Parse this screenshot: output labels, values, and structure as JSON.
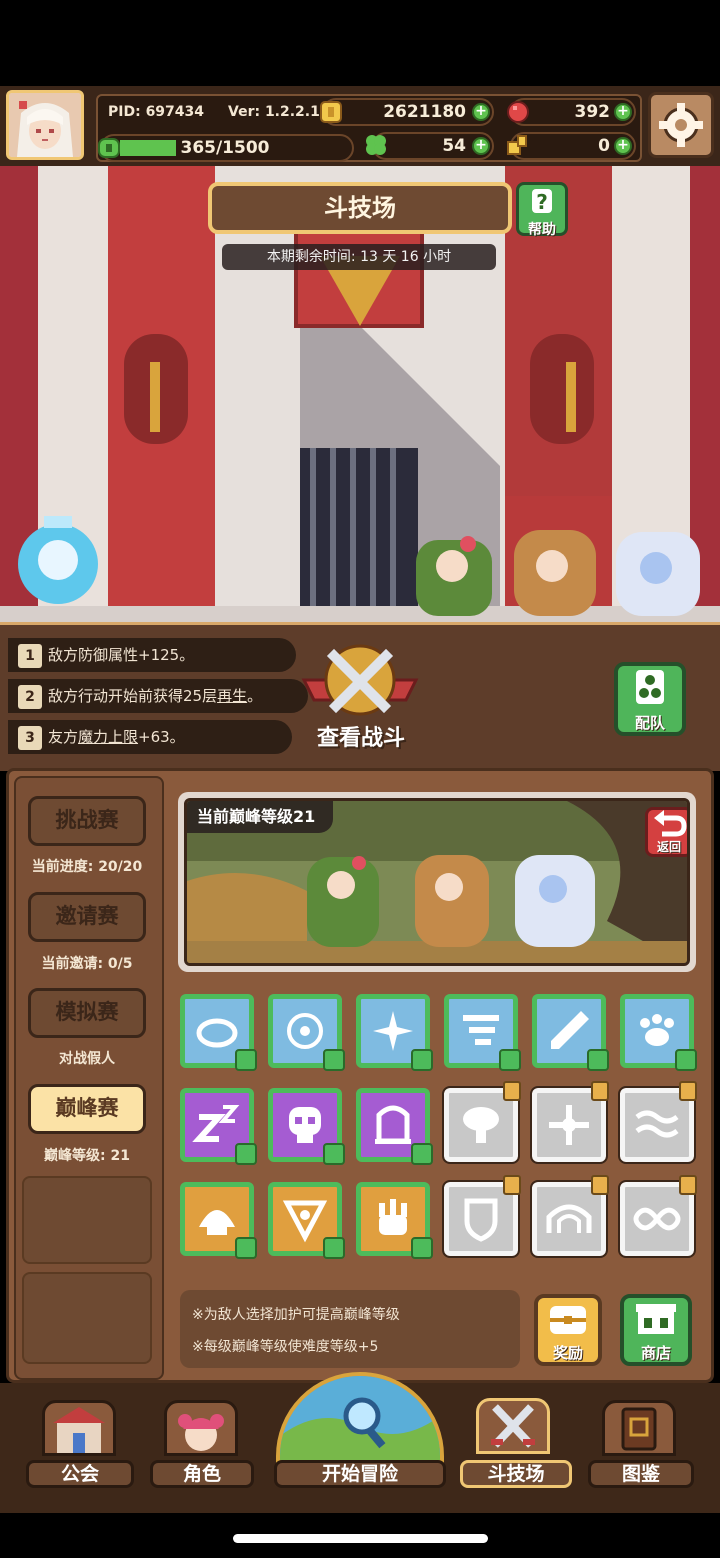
{
  "status_bar": {
    "pid": "PID: 697434",
    "version": "Ver: 1.2.2.1",
    "gold": "2621180",
    "gems": "392",
    "stamina": "365/1500",
    "stamina_fill": 0.243,
    "clover": "54",
    "tickets": "0"
  },
  "arena": {
    "title": "斗技场",
    "help_label": "帮助",
    "timer": "本期剩余时间: 13 天 16 小时"
  },
  "buffs": [
    {
      "num": "1",
      "text": "敌方防御属性+125。"
    },
    {
      "num": "2",
      "text_a": "敌方行动开始前获得25层",
      "text_u": "再生",
      "text_b": "。"
    },
    {
      "num": "3",
      "text_a": "友方",
      "text_u": "魔力上限",
      "text_b": "+63。"
    }
  ],
  "view_battle_label": "查看战斗",
  "team_label": "配队",
  "modes": [
    {
      "label": "挑战赛",
      "sub": "当前进度: 20/20"
    },
    {
      "label": "邀请赛",
      "sub": "当前邀请: 0/5"
    },
    {
      "label": "模拟赛",
      "sub": "对战假人"
    },
    {
      "label": "巅峰赛",
      "sub": "巅峰等级: 21"
    }
  ],
  "peak": {
    "level_label": "当前巅峰等级21",
    "back_label": "返回"
  },
  "notes": [
    "※为敌人选择加护可提高巅峰等级",
    "※每级巅峰等级使难度等级+5"
  ],
  "reward_label": "奖励",
  "shop_label": "商店",
  "nav": [
    "公会",
    "角色",
    "开始冒险",
    "斗技场",
    "图鉴"
  ],
  "colors": {
    "accent_green": "#4fb55a",
    "gold_border": "#f0c774",
    "brown_panel": "#8a5a3c"
  }
}
